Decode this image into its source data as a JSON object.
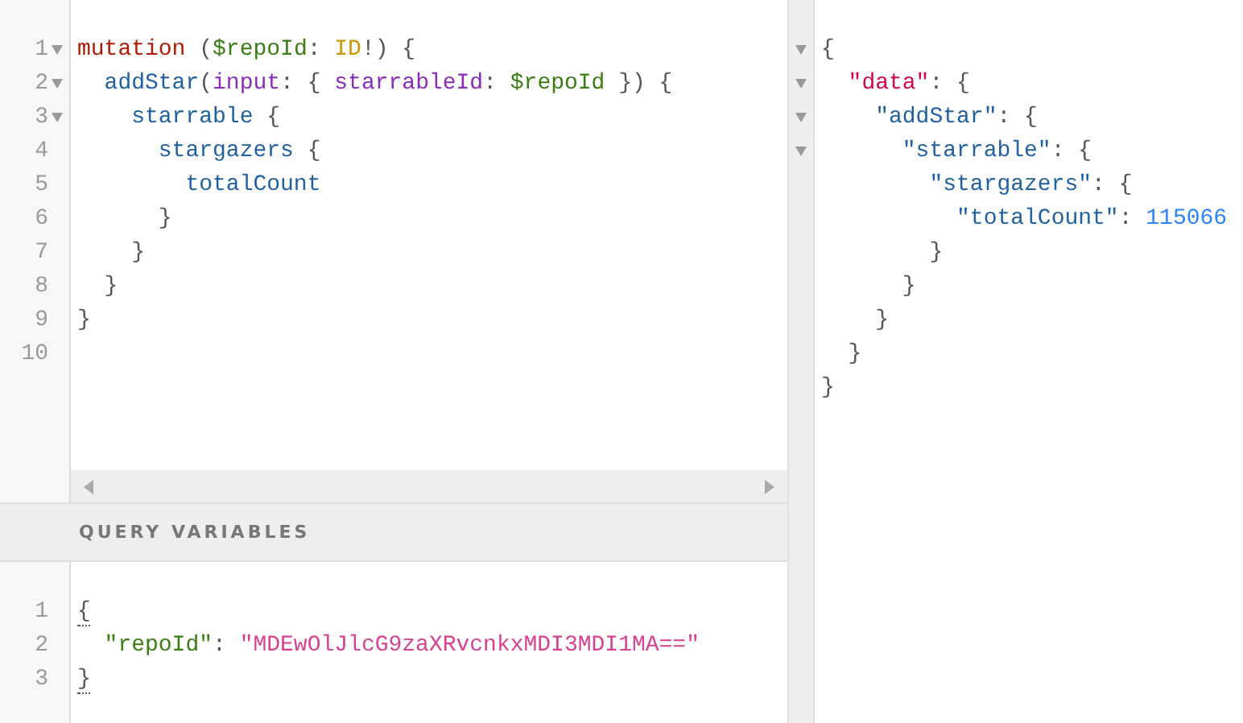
{
  "query_editor": {
    "lines": [
      {
        "number": "1",
        "foldable": true,
        "tokens": [
          {
            "kind": "keyword",
            "text": "mutation"
          },
          {
            "kind": "punct",
            "text": " ("
          },
          {
            "kind": "variable",
            "text": "$repoId"
          },
          {
            "kind": "punct",
            "text": ": "
          },
          {
            "kind": "type",
            "text": "ID"
          },
          {
            "kind": "punct",
            "text": "!) {"
          }
        ]
      },
      {
        "number": "2",
        "foldable": true,
        "tokens": [
          {
            "kind": "field",
            "text": "  addStar"
          },
          {
            "kind": "punct",
            "text": "("
          },
          {
            "kind": "argument",
            "text": "input"
          },
          {
            "kind": "punct",
            "text": ": { "
          },
          {
            "kind": "argument",
            "text": "starrableId"
          },
          {
            "kind": "punct",
            "text": ": "
          },
          {
            "kind": "variable",
            "text": "$repoId"
          },
          {
            "kind": "punct",
            "text": " }) {"
          }
        ]
      },
      {
        "number": "3",
        "foldable": true,
        "tokens": [
          {
            "kind": "field",
            "text": "    starrable"
          },
          {
            "kind": "punct",
            "text": " {"
          }
        ]
      },
      {
        "number": "4",
        "foldable": false,
        "tokens": [
          {
            "kind": "field",
            "text": "      stargazers"
          },
          {
            "kind": "punct",
            "text": " {"
          }
        ]
      },
      {
        "number": "5",
        "foldable": false,
        "tokens": [
          {
            "kind": "field",
            "text": "        totalCount"
          }
        ]
      },
      {
        "number": "6",
        "foldable": false,
        "tokens": [
          {
            "kind": "punct",
            "text": "      }"
          }
        ]
      },
      {
        "number": "7",
        "foldable": false,
        "tokens": [
          {
            "kind": "punct",
            "text": "    }"
          }
        ]
      },
      {
        "number": "8",
        "foldable": false,
        "tokens": [
          {
            "kind": "punct",
            "text": "  }"
          }
        ]
      },
      {
        "number": "9",
        "foldable": false,
        "tokens": [
          {
            "kind": "punct",
            "text": "}"
          }
        ]
      },
      {
        "number": "10",
        "foldable": false
      }
    ]
  },
  "variables": {
    "title": "QUERY VARIABLES",
    "lines": [
      {
        "number": "1",
        "tokens": [
          {
            "kind": "matched-bracket",
            "text": "{"
          }
        ]
      },
      {
        "number": "2",
        "tokens": [
          {
            "kind": "variable",
            "text": "  \"repoId\""
          },
          {
            "kind": "punct",
            "text": ": "
          },
          {
            "kind": "string",
            "text": "\"MDEwOlJlcG9zaXRvcnkxMDI3MDI1MA==\""
          }
        ]
      },
      {
        "number": "3",
        "tokens": [
          {
            "kind": "matched-bracket",
            "text": "}"
          }
        ]
      }
    ]
  },
  "result": {
    "lines": [
      {
        "foldable": true,
        "tokens": [
          {
            "kind": "punct",
            "text": "{"
          }
        ]
      },
      {
        "foldable": true,
        "tokens": [
          {
            "kind": "root-key",
            "text": "  \"data\""
          },
          {
            "kind": "punct",
            "text": ": {"
          }
        ]
      },
      {
        "foldable": true,
        "tokens": [
          {
            "kind": "field",
            "text": "    \"addStar\""
          },
          {
            "kind": "punct",
            "text": ": {"
          }
        ]
      },
      {
        "foldable": true,
        "tokens": [
          {
            "kind": "field",
            "text": "      \"starrable\""
          },
          {
            "kind": "punct",
            "text": ": {"
          }
        ]
      },
      {
        "foldable": false,
        "tokens": [
          {
            "kind": "field",
            "text": "        \"stargazers\""
          },
          {
            "kind": "punct",
            "text": ": {"
          }
        ]
      },
      {
        "foldable": false,
        "tokens": [
          {
            "kind": "field",
            "text": "          \"totalCount\""
          },
          {
            "kind": "punct",
            "text": ": "
          },
          {
            "kind": "number",
            "text": "115066"
          }
        ]
      },
      {
        "foldable": false,
        "tokens": [
          {
            "kind": "punct",
            "text": "        }"
          }
        ]
      },
      {
        "foldable": false,
        "tokens": [
          {
            "kind": "punct",
            "text": "      }"
          }
        ]
      },
      {
        "foldable": false,
        "tokens": [
          {
            "kind": "punct",
            "text": "    }"
          }
        ]
      },
      {
        "foldable": false,
        "tokens": [
          {
            "kind": "punct",
            "text": "  }"
          }
        ]
      },
      {
        "foldable": false,
        "tokens": [
          {
            "kind": "punct",
            "text": "}"
          }
        ]
      }
    ]
  }
}
